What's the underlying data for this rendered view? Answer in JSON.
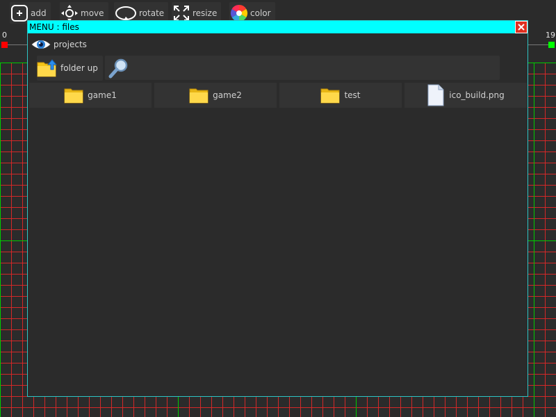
{
  "toolbar": {
    "tools": [
      {
        "label": "add",
        "icon": "add-icon"
      },
      {
        "label": "move",
        "icon": "move-icon"
      },
      {
        "label": "rotate",
        "icon": "rotate-icon"
      },
      {
        "label": "resize",
        "icon": "resize-icon"
      },
      {
        "label": "color",
        "icon": "color-wheel-icon"
      }
    ]
  },
  "ruler": {
    "left_value": "0",
    "right_value": "19",
    "left_marker_color": "#ff0000",
    "right_marker_color": "#00ff00"
  },
  "dialog": {
    "title": "MENU : files",
    "accent_color": "#00ffff",
    "projects_label": "projects",
    "folder_up_label": "folder up",
    "search_value": "",
    "files": [
      {
        "name": "game1",
        "type": "folder"
      },
      {
        "name": "game2",
        "type": "folder"
      },
      {
        "name": "test",
        "type": "folder"
      },
      {
        "name": "ico_build.png",
        "type": "file"
      }
    ]
  }
}
